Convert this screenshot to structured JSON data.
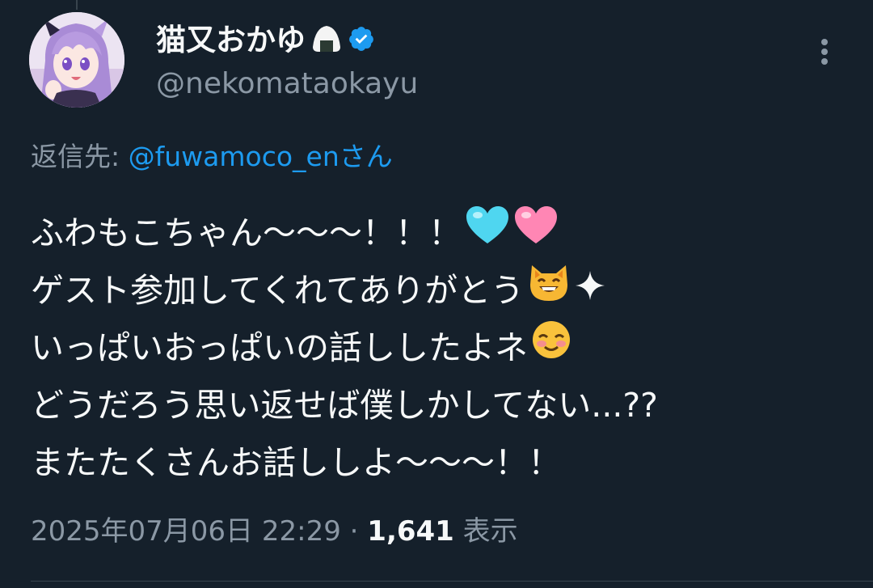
{
  "tweet": {
    "author": {
      "display_name": "猫又おかゆ",
      "name_emoji_icon": "rice-ball-icon",
      "verified_icon": "verified-badge-icon",
      "handle": "@nekomataokayu"
    },
    "reply": {
      "prefix": "返信先: ",
      "mention": "@fuwamoco_en",
      "suffix": "さん"
    },
    "lines": [
      {
        "text": "ふわもこちゃん〜〜〜！！！",
        "emojis": [
          "light-blue-heart-icon",
          "pink-heart-icon"
        ]
      },
      {
        "text": "ゲスト参加してくれてありがとう",
        "emojis": [
          "grinning-cat-icon",
          "sparkle-icon"
        ]
      },
      {
        "text": "いっぱいおっぱいの話ししたよネ",
        "emojis": [
          "smiling-face-icon"
        ]
      },
      {
        "text": "どうだろう思い返せば僕しかしてない...??",
        "emojis": []
      },
      {
        "text": "またたくさんお話ししよ〜〜〜！！",
        "emojis": []
      }
    ],
    "timestamp": "2025年07月06日 22:29",
    "separator": " · ",
    "views_count": "1,641",
    "views_label": " 表示"
  },
  "colors": {
    "background": "#15202b",
    "text_primary": "#f7f9f9",
    "text_secondary": "#8b98a5",
    "link": "#1d9bf0",
    "verified": "#1d9bf0"
  }
}
